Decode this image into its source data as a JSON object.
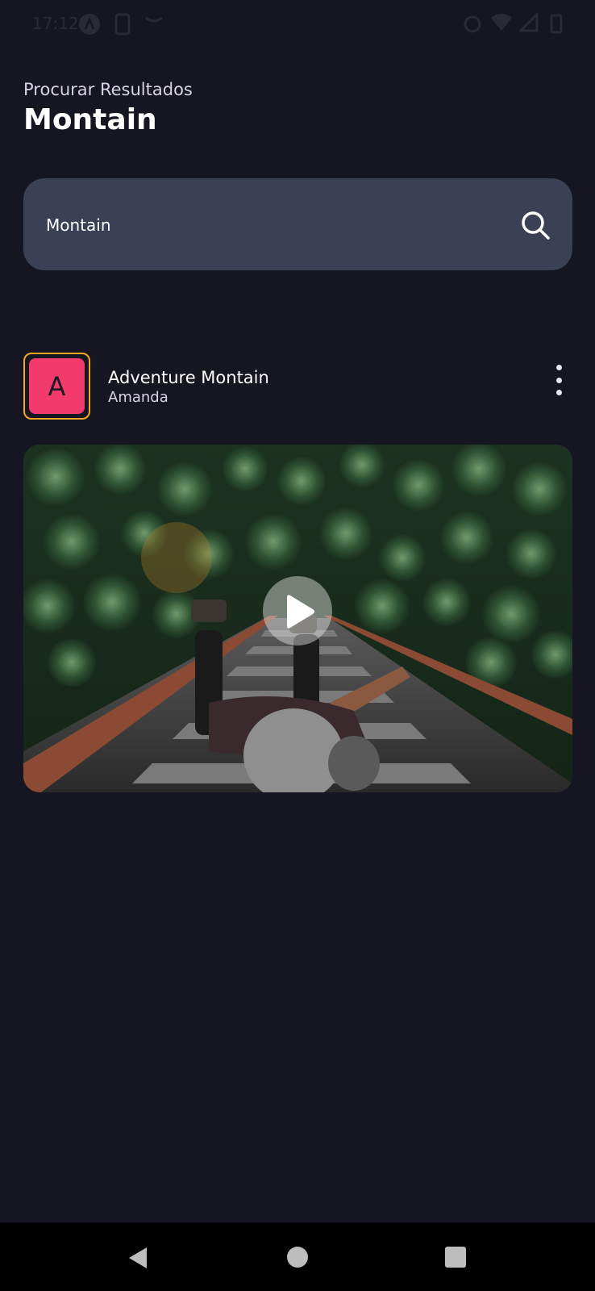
{
  "status_bar": {
    "time": "17:12",
    "icons": [
      "app-icon",
      "screenshot-icon",
      "notification-icon",
      "alarm-icon",
      "wifi-icon",
      "signal-icon",
      "battery-icon"
    ]
  },
  "header": {
    "subtitle": "Procurar Resultados",
    "title": "Montain"
  },
  "search": {
    "value": "Montain",
    "icon": "search-icon"
  },
  "results": [
    {
      "avatar_letter": "A",
      "title": "Adventure Montain",
      "author": "Amanda",
      "menu_icon": "more-vertical-icon",
      "media": "video",
      "play_icon": "play-icon"
    }
  ],
  "nav_bar": {
    "icons": [
      "back-icon",
      "home-icon",
      "recents-icon"
    ]
  },
  "colors": {
    "background": "#161622",
    "search_background": "#3a4154",
    "avatar_fill": "#f23b6c",
    "avatar_border": "#f5a623"
  }
}
